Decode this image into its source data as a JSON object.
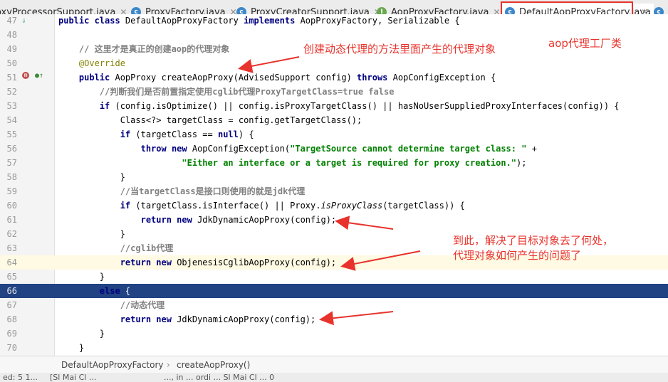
{
  "tabs": [
    {
      "label": "oxyProcessorSupport.java",
      "icon": "class-icon",
      "active": false
    },
    {
      "label": "ProxyFactory.java",
      "icon": "class-icon",
      "active": false
    },
    {
      "label": "ProxyCreatorSupport.java",
      "icon": "class-icon",
      "active": false
    },
    {
      "label": "AopProxyFactory.java",
      "icon": "interface-icon",
      "active": false
    },
    {
      "label": "DefaultAopProxyFactory.java",
      "icon": "class-icon",
      "active": true
    },
    {
      "label": "J",
      "icon": "class-icon",
      "active": false
    }
  ],
  "lines": [
    {
      "num": "47",
      "segs": [
        [
          "kw",
          "public class "
        ],
        [
          "",
          "DefaultAopProxyFactory "
        ],
        [
          "kw",
          "implements "
        ],
        [
          "",
          "AopProxyFactory, Serializable {"
        ]
      ]
    },
    {
      "num": "48",
      "segs": []
    },
    {
      "num": "49",
      "segs": [
        [
          "",
          "    "
        ],
        [
          "cmb",
          "// 这里才是真正的创建aop的代理对象"
        ]
      ]
    },
    {
      "num": "50",
      "segs": [
        [
          "",
          "    "
        ],
        [
          "an",
          "@Override"
        ]
      ]
    },
    {
      "num": "51",
      "segs": [
        [
          "",
          "    "
        ],
        [
          "kw",
          "public "
        ],
        [
          "",
          "AopProxy createAopProxy(AdvisedSupport config) "
        ],
        [
          "kw",
          "throws "
        ],
        [
          "",
          "AopConfigException {"
        ]
      ]
    },
    {
      "num": "52",
      "segs": [
        [
          "",
          "        "
        ],
        [
          "cmb",
          "//判断我们是否前置指定使用cglib代理ProxyTargetClass=true false"
        ]
      ]
    },
    {
      "num": "53",
      "segs": [
        [
          "",
          "        "
        ],
        [
          "kw",
          "if "
        ],
        [
          "",
          "(config.isOptimize() || config.isProxyTargetClass() || hasNoUserSuppliedProxyInterfaces(config)) {"
        ]
      ]
    },
    {
      "num": "54",
      "segs": [
        [
          "",
          "            Class<?> targetClass = config.getTargetClass();"
        ]
      ]
    },
    {
      "num": "55",
      "segs": [
        [
          "",
          "            "
        ],
        [
          "kw",
          "if "
        ],
        [
          "",
          "(targetClass == "
        ],
        [
          "kw",
          "null"
        ],
        [
          "",
          ") {"
        ]
      ]
    },
    {
      "num": "56",
      "segs": [
        [
          "",
          "                "
        ],
        [
          "kw",
          "throw new "
        ],
        [
          "",
          "AopConfigException("
        ],
        [
          "st",
          "\"TargetSource cannot determine target class: \""
        ],
        [
          "",
          " +"
        ]
      ]
    },
    {
      "num": "57",
      "segs": [
        [
          "",
          "                        "
        ],
        [
          "st",
          "\"Either an interface or a target is required for proxy creation.\""
        ],
        [
          "",
          ");"
        ]
      ]
    },
    {
      "num": "58",
      "segs": [
        [
          "",
          "            }"
        ]
      ]
    },
    {
      "num": "59",
      "segs": [
        [
          "",
          "            "
        ],
        [
          "cmb",
          "//当targetClass是接口则使用的就是jdk代理"
        ]
      ]
    },
    {
      "num": "60",
      "segs": [
        [
          "",
          "            "
        ],
        [
          "kw",
          "if "
        ],
        [
          "",
          "(targetClass.isInterface() || Proxy."
        ],
        [
          "it",
          "isProxyClass"
        ],
        [
          "",
          "(targetClass)) {"
        ]
      ]
    },
    {
      "num": "61",
      "segs": [
        [
          "",
          "                "
        ],
        [
          "kw",
          "return new "
        ],
        [
          "",
          "JdkDynamicAopProxy(config);"
        ]
      ]
    },
    {
      "num": "62",
      "segs": [
        [
          "",
          "            }"
        ]
      ]
    },
    {
      "num": "63",
      "segs": [
        [
          "",
          "            "
        ],
        [
          "cmb",
          "//cglib代理"
        ]
      ]
    },
    {
      "num": "64",
      "segs": [
        [
          "",
          "            "
        ],
        [
          "kw",
          "return new "
        ],
        [
          "",
          "ObjenesisCglibAopProxy(config);"
        ]
      ]
    },
    {
      "num": "65",
      "segs": [
        [
          "",
          "        }"
        ]
      ]
    },
    {
      "num": "66",
      "segs": [
        [
          "",
          "        "
        ],
        [
          "kw",
          "else "
        ],
        [
          "",
          "{"
        ]
      ]
    },
    {
      "num": "67",
      "segs": [
        [
          "",
          "            "
        ],
        [
          "cmb",
          "//动态代理"
        ]
      ]
    },
    {
      "num": "68",
      "segs": [
        [
          "",
          "            "
        ],
        [
          "kw",
          "return new "
        ],
        [
          "",
          "JdkDynamicAopProxy(config);"
        ]
      ]
    },
    {
      "num": "69",
      "segs": [
        [
          "",
          "        }"
        ]
      ]
    },
    {
      "num": "70",
      "segs": [
        [
          "",
          "    }"
        ]
      ]
    }
  ],
  "annotations": {
    "tab_note": "aop代理工厂类",
    "create_note": "创建动态代理的方法里面产生的代理对象",
    "result_note_line1": "到此，解决了目标对象去了何处，",
    "result_note_line2": "代理对象如何产生的问题了"
  },
  "breadcrumb": {
    "class_name": "DefaultAopProxyFactory",
    "separator": "›",
    "method": "createAopProxy()"
  },
  "status": {
    "left": "ed: 5 1...",
    "mid": "[Sl Mai Cl ...",
    "right": "..., in ... ordi ... Sl Mai Cl ... 0"
  },
  "colors": {
    "annotation": "#e8332c",
    "selection": "#214283",
    "keyword": "#000080",
    "string": "#008000",
    "comment": "#808080"
  }
}
